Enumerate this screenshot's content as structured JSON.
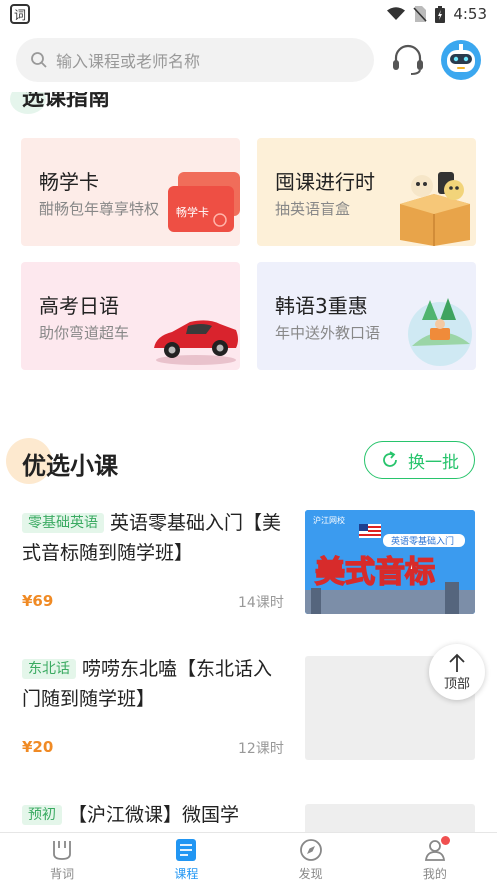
{
  "status_bar": {
    "app_icon_text": "词",
    "time": "4:53"
  },
  "search": {
    "placeholder": "输入课程或老师名称"
  },
  "section_guide": {
    "title": "选课指南",
    "cards": [
      {
        "title": "畅学卡",
        "subtitle": "酣畅包年尊享特权",
        "art_label": "畅学卡"
      },
      {
        "title": "囤课进行时",
        "subtitle": "抽英语盲盒"
      },
      {
        "title": "高考日语",
        "subtitle": "助你弯道超车"
      },
      {
        "title": "韩语3重惠",
        "subtitle": "年中送外教口语"
      }
    ]
  },
  "section_picks": {
    "title": "优选小课",
    "swap_label": "换一批",
    "courses": [
      {
        "tag": "零基础英语",
        "title": "英语零基础入门【美式音标随到随学班】",
        "price": "¥69",
        "hours": "14课时",
        "thumb_brand": "沪江网校",
        "thumb_badge": "英语零基础入门",
        "thumb_main": "美式音标"
      },
      {
        "tag": "东北话",
        "title": "唠唠东北嗑【东北话入门随到随学班】",
        "price": "¥20",
        "hours": "12课时"
      },
      {
        "tag": "预初",
        "title": "【沪江微课】微国学",
        "price": "",
        "hours": ""
      }
    ]
  },
  "back_to_top": "顶部",
  "tabs": [
    {
      "label": "背词",
      "icon": "bookmark-icon",
      "active": false
    },
    {
      "label": "课程",
      "icon": "course-list-icon",
      "active": true
    },
    {
      "label": "发现",
      "icon": "compass-icon",
      "active": false
    },
    {
      "label": "我的",
      "icon": "profile-icon",
      "active": false
    }
  ],
  "colors": {
    "accent_green": "#28c46c",
    "accent_blue": "#2196f3",
    "price_orange": "#f08a24"
  }
}
